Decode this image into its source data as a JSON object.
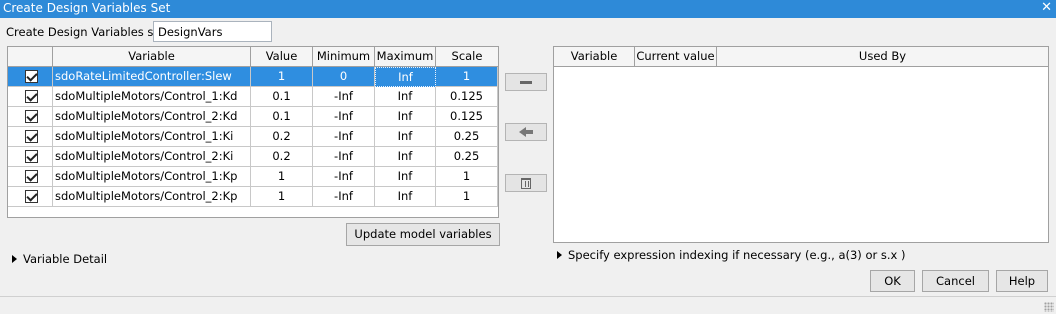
{
  "window": {
    "title": "Create Design Variables Set",
    "close_glyph": "✕"
  },
  "set": {
    "label": "Create Design Variables set:",
    "value": "DesignVars"
  },
  "left_table": {
    "headers": [
      "",
      "Variable",
      "Value",
      "Minimum",
      "Maximum",
      "Scale"
    ],
    "rows": [
      {
        "checked": true,
        "selected": true,
        "variable": "sdoRateLimitedController:Slew",
        "value": "1",
        "minimum": "0",
        "maximum": "Inf",
        "scale": "1"
      },
      {
        "checked": true,
        "selected": false,
        "variable": "sdoMultipleMotors/Control_1:Kd",
        "value": "0.1",
        "minimum": "-Inf",
        "maximum": "Inf",
        "scale": "0.125"
      },
      {
        "checked": true,
        "selected": false,
        "variable": "sdoMultipleMotors/Control_2:Kd",
        "value": "0.1",
        "minimum": "-Inf",
        "maximum": "Inf",
        "scale": "0.125"
      },
      {
        "checked": true,
        "selected": false,
        "variable": "sdoMultipleMotors/Control_1:Ki",
        "value": "0.2",
        "minimum": "-Inf",
        "maximum": "Inf",
        "scale": "0.25"
      },
      {
        "checked": true,
        "selected": false,
        "variable": "sdoMultipleMotors/Control_2:Ki",
        "value": "0.2",
        "minimum": "-Inf",
        "maximum": "Inf",
        "scale": "0.25"
      },
      {
        "checked": true,
        "selected": false,
        "variable": "sdoMultipleMotors/Control_1:Kp",
        "value": "1",
        "minimum": "-Inf",
        "maximum": "Inf",
        "scale": "1"
      },
      {
        "checked": true,
        "selected": false,
        "variable": "sdoMultipleMotors/Control_2:Kp",
        "value": "1",
        "minimum": "-Inf",
        "maximum": "Inf",
        "scale": "1"
      }
    ]
  },
  "buttons": {
    "update": "Update model variables",
    "ok": "OK",
    "cancel": "Cancel",
    "help": "Help"
  },
  "middle_icons": [
    "minus-icon",
    "arrow-left-icon",
    "trash-icon"
  ],
  "variable_detail": "Variable Detail",
  "right_table": {
    "headers": [
      "Variable",
      "Current value",
      "Used By"
    ]
  },
  "spec_text": "Specify expression indexing if necessary (e.g., a(3) or s.x )",
  "colors": {
    "titlebar": "#2e8ad8",
    "selection": "#2f8ee0"
  }
}
